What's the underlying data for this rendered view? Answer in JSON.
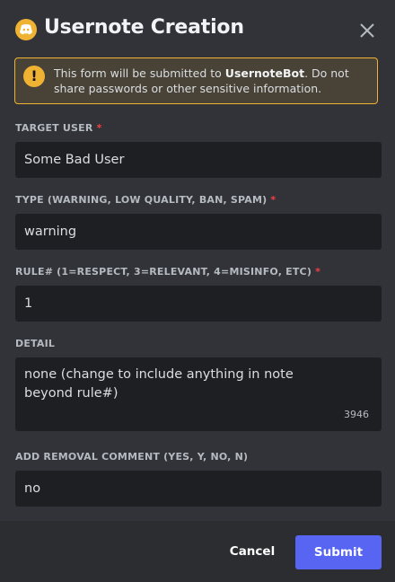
{
  "header": {
    "title": "Usernote Creation",
    "app_icon": "discord-logo-icon",
    "close_icon": "close-icon"
  },
  "notice": {
    "icon": "warning-icon",
    "icon_glyph": "!",
    "text_before": "This form will be submitted to ",
    "bot_name": "UsernoteBot",
    "text_after": ". Do not share passwords or other sensitive information."
  },
  "fields": [
    {
      "label": "TARGET USER",
      "required": "*",
      "value": "Some Bad User"
    },
    {
      "label": "TYPE (WARNING, LOW QUALITY, BAN, SPAM)",
      "required": "*",
      "value": "warning"
    },
    {
      "label": "RULE# (1=RESPECT, 3=RELEVANT, 4=MISINFO, ETC)",
      "required": "*",
      "value": "1"
    },
    {
      "label": "DETAIL",
      "value": "none (change to include anything in note beyond rule#)",
      "counter": "3946"
    },
    {
      "label": "ADD REMOVAL COMMENT (YES, Y, NO, N)",
      "value": "no"
    }
  ],
  "footer": {
    "cancel_label": "Cancel",
    "submit_label": "Submit"
  },
  "colors": {
    "accent": "#5865f2",
    "warning": "#f0b232",
    "required": "#f23f43"
  }
}
